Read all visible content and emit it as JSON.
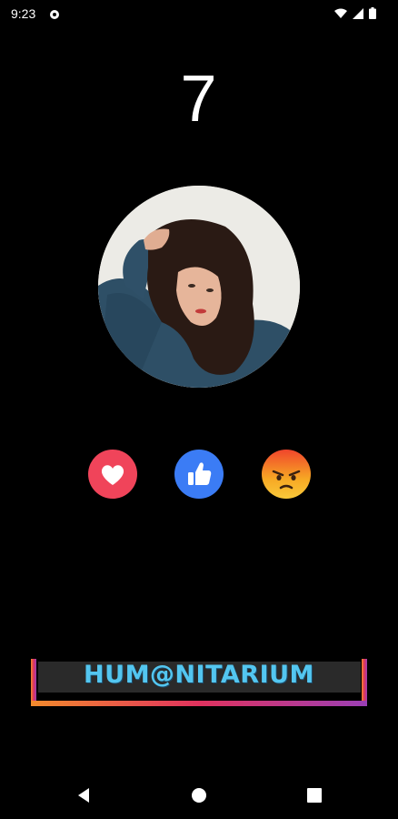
{
  "status_bar": {
    "time": "9:23",
    "icons": [
      "notification-icon",
      "wifi-icon",
      "signal-icon",
      "battery-icon"
    ]
  },
  "counter": {
    "value": "7"
  },
  "profile": {
    "avatar": "profile-photo"
  },
  "reactions": [
    {
      "name": "heart",
      "icon": "heart-icon",
      "color": "#f0445a"
    },
    {
      "name": "like",
      "icon": "thumbs-up-icon",
      "color": "#3b7cf5"
    },
    {
      "name": "angry",
      "icon": "angry-face-icon",
      "color": "#f5a623"
    }
  ],
  "banner": {
    "text": "HUM@NITARIUM",
    "text_color": "#53c6f0",
    "frame_gradient": [
      "#f38a2c",
      "#e0325e",
      "#9b3fb5"
    ]
  },
  "nav_bar": {
    "buttons": [
      "back-icon",
      "home-icon",
      "recents-icon"
    ]
  }
}
